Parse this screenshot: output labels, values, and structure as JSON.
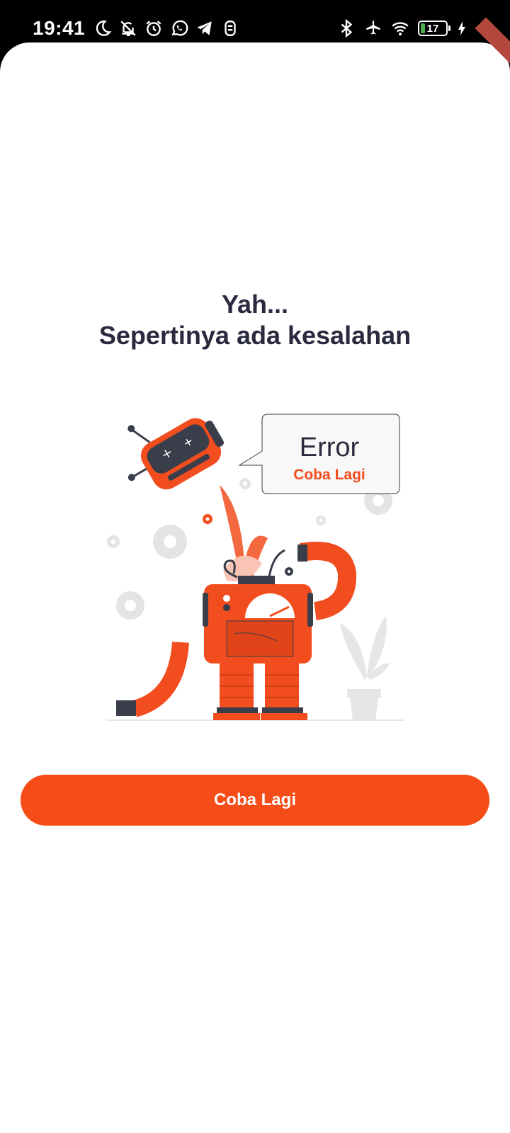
{
  "status_bar": {
    "time": "19:41",
    "battery_level": "17",
    "left_icons": [
      "moon-icon",
      "bell-off-icon",
      "alarm-icon",
      "whatsapp-icon",
      "telegram-icon",
      "app-icon"
    ],
    "right_icons": [
      "bluetooth-icon",
      "airplane-icon",
      "wifi-icon",
      "battery-icon",
      "charging-icon"
    ]
  },
  "error_screen": {
    "headline_line1": "Yah...",
    "headline_line2": "Sepertinya ada kesalahan",
    "illustration": {
      "bubble_title": "Error",
      "bubble_subtitle": "Coba Lagi"
    },
    "retry_button_label": "Coba Lagi"
  },
  "colors": {
    "accent": "#F64D18",
    "heading": "#2A2A3F",
    "background": "#FFFFFF"
  }
}
